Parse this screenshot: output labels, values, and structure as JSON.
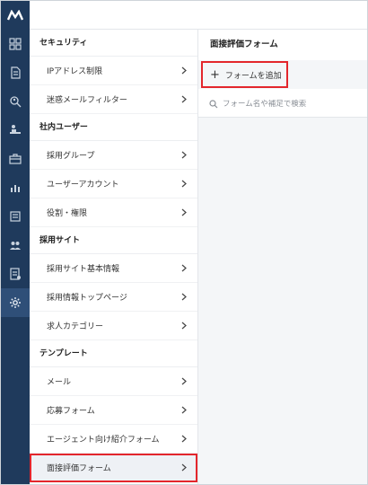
{
  "app": {
    "logo_text": "M"
  },
  "menu": {
    "sections": [
      {
        "title": "セキュリティ",
        "items": [
          "IPアドレス制限",
          "迷惑メールフィルター"
        ]
      },
      {
        "title": "社内ユーザー",
        "items": [
          "採用グループ",
          "ユーザーアカウント",
          "役割・権限"
        ]
      },
      {
        "title": "採用サイト",
        "items": [
          "採用サイト基本情報",
          "採用情報トップページ",
          "求人カテゴリー"
        ]
      },
      {
        "title": "テンプレート",
        "items": [
          "メール",
          "応募フォーム",
          "エージェント向け紹介フォーム",
          "面接評価フォーム"
        ]
      }
    ],
    "selected": "面接評価フォーム"
  },
  "main": {
    "title": "面接評価フォーム",
    "add_label": "フォームを追加",
    "search_placeholder": "フォーム名や補足で検索"
  },
  "colors": {
    "rail": "#1f3a5c",
    "highlight": "#e3262c",
    "panel_bg": "#f4f6f8"
  }
}
